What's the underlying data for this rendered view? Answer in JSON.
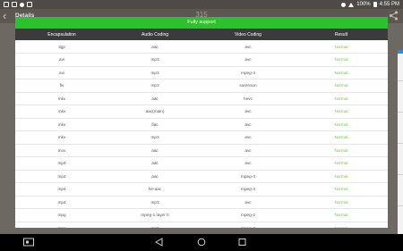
{
  "status_bar": {
    "battery": "100%",
    "time": "4:55 PM"
  },
  "header": {
    "title": "Details",
    "page_number": "315"
  },
  "dialog": {
    "title": "Fully support",
    "columns": [
      "Encapsulation",
      "Audio Coding",
      "Video Coding",
      "Result"
    ],
    "rows": [
      [
        "3gp",
        "aac",
        "avc",
        "Normal"
      ],
      [
        "avi",
        "mp3",
        "avc",
        "Normal"
      ],
      [
        "avi",
        "mp3",
        "mpeg-4",
        "Normal"
      ],
      [
        "flv",
        "mp3",
        "sorenson",
        "Normal"
      ],
      [
        "mkv",
        "aac",
        "hevc",
        "Normal"
      ],
      [
        "mkv",
        "aac(main)",
        "avc",
        "Normal"
      ],
      [
        "mkv",
        "flac",
        "avc",
        "Normal"
      ],
      [
        "mkv",
        "mp3",
        "avc",
        "Normal"
      ],
      [
        "mov",
        "aac",
        "avc",
        "Normal"
      ],
      [
        "mp4",
        "aac",
        "avc",
        "Normal"
      ],
      [
        "mp4",
        "aac",
        "mpeg-4",
        "Normal"
      ],
      [
        "mp4",
        "he-aac",
        "mpeg-4",
        "Normal"
      ],
      [
        "mp4",
        "mp3",
        "avc",
        "Normal"
      ],
      [
        "mpg",
        "mpeg-1 layer II",
        "mpeg-2",
        "Normal"
      ],
      [
        "mpg",
        "mp2",
        "mpeg-2",
        "Normal"
      ]
    ]
  },
  "colors": {
    "accent_green": "#2bc22b",
    "result_green": "#7bbf4a",
    "table_header": "#3b3b3b"
  },
  "icons": {
    "back": "chevron-left-icon",
    "share": "share-icon",
    "nav": [
      "screenshot-icon",
      "back-triangle-icon",
      "home-circle-icon",
      "recents-square-icon"
    ]
  }
}
